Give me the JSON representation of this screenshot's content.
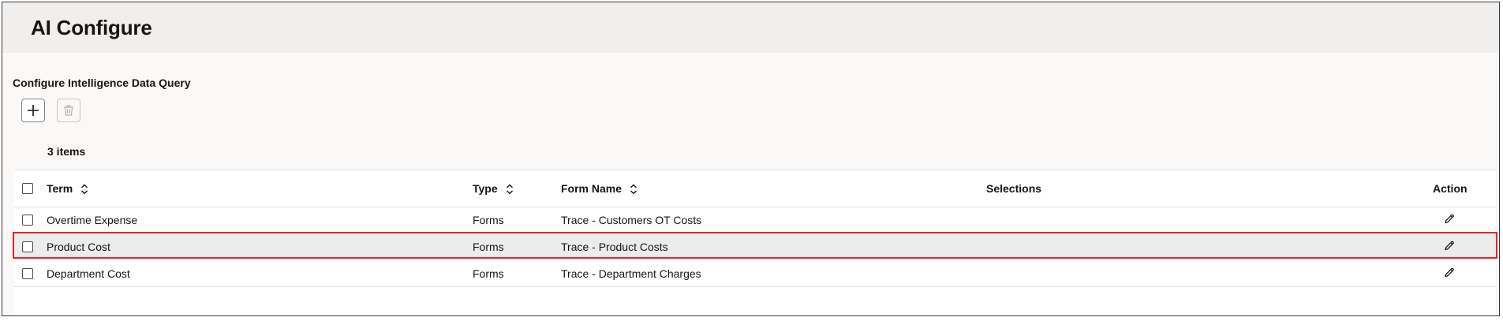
{
  "header": {
    "title": "AI Configure"
  },
  "section": {
    "title": "Configure Intelligence Data Query"
  },
  "toolbar": {
    "add_icon": "plus-icon",
    "delete_icon": "trash-icon"
  },
  "table": {
    "item_count": "3 items",
    "columns": {
      "term": "Term",
      "type": "Type",
      "form_name": "Form Name",
      "selections": "Selections",
      "action": "Action"
    },
    "rows": [
      {
        "term": "Overtime Expense",
        "type": "Forms",
        "form_name": "Trace - Customers OT Costs",
        "selections": ""
      },
      {
        "term": "Product Cost",
        "type": "Forms",
        "form_name": "Trace - Product Costs",
        "selections": "",
        "highlighted": true
      },
      {
        "term": "Department Cost",
        "type": "Forms",
        "form_name": "Trace - Department Charges",
        "selections": ""
      }
    ]
  },
  "colors": {
    "highlight_border": "#e3262b",
    "selected_row_bg": "#ececec",
    "header_bg": "#f1efed"
  }
}
